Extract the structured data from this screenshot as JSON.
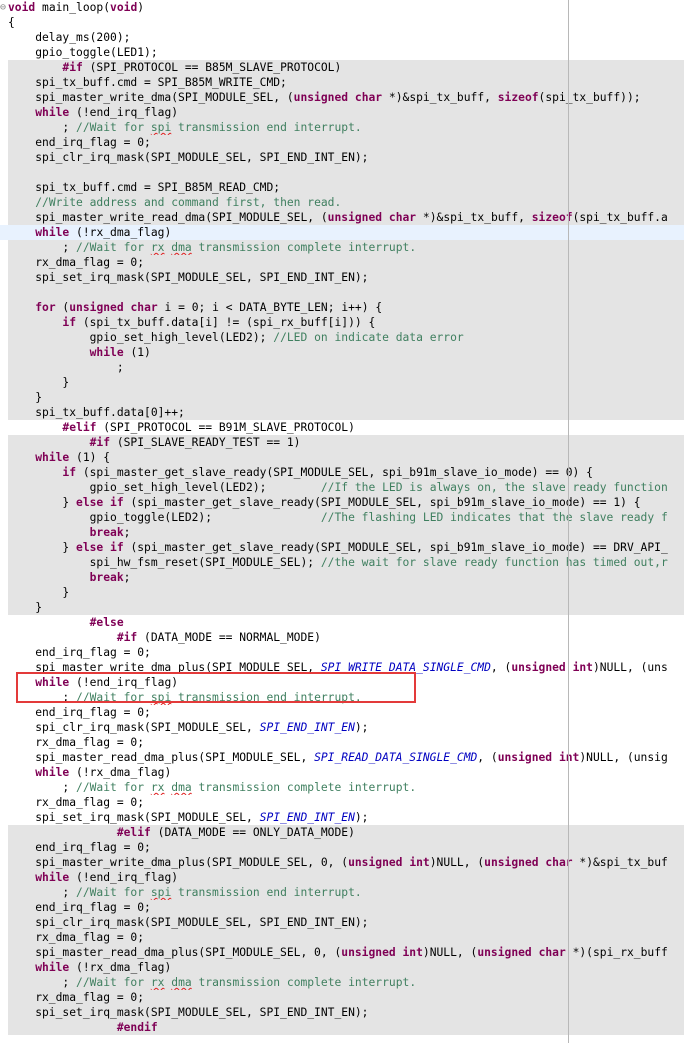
{
  "fold_marker": "⊖",
  "highlight_color": "#e33a3a",
  "lines": [
    {
      "text": "void main_loop(void)",
      "indent": 0
    },
    {
      "text": "{",
      "indent": 0
    },
    {
      "text": "    delay_ms(200);",
      "indent": 0
    },
    {
      "text": "    gpio_toggle(LED1);",
      "indent": 0
    },
    {
      "text": "        #if (SPI_PROTOCOL == B85M_SLAVE_PROTOCOL)",
      "indent": 0,
      "gray": true
    },
    {
      "text": "    spi_tx_buff.cmd = SPI_B85M_WRITE_CMD;",
      "indent": 0,
      "gray": true
    },
    {
      "text": "    spi_master_write_dma(SPI_MODULE_SEL, (unsigned char *)&spi_tx_buff, sizeof(spi_tx_buff));",
      "indent": 0,
      "gray": true
    },
    {
      "text": "    while (!end_irq_flag)",
      "indent": 0,
      "gray": true
    },
    {
      "text": "        ; //Wait for spi transmission end interrupt.",
      "indent": 0,
      "gray": true
    },
    {
      "text": "    end_irq_flag = 0;",
      "indent": 0,
      "gray": true
    },
    {
      "text": "    spi_clr_irq_mask(SPI_MODULE_SEL, SPI_END_INT_EN);",
      "indent": 0,
      "gray": true
    },
    {
      "text": "",
      "indent": 0,
      "gray": true
    },
    {
      "text": "    spi_tx_buff.cmd = SPI_B85M_READ_CMD;",
      "indent": 0,
      "gray": true
    },
    {
      "text": "    //Write address and command first, then read.",
      "indent": 0,
      "gray": true
    },
    {
      "text": "    spi_master_write_read_dma(SPI_MODULE_SEL, (unsigned char *)&spi_tx_buff, sizeof(spi_tx_buff.a",
      "indent": 0,
      "gray": true
    },
    {
      "text": "    while (!rx_dma_flag)",
      "indent": 0,
      "sel": true
    },
    {
      "text": "        ; //Wait for rx dma transmission complete interrupt.",
      "indent": 0,
      "gray": true
    },
    {
      "text": "    rx_dma_flag = 0;",
      "indent": 0,
      "gray": true
    },
    {
      "text": "    spi_set_irq_mask(SPI_MODULE_SEL, SPI_END_INT_EN);",
      "indent": 0,
      "gray": true
    },
    {
      "text": "",
      "indent": 0,
      "gray": true
    },
    {
      "text": "    for (unsigned char i = 0; i < DATA_BYTE_LEN; i++) {",
      "indent": 0,
      "gray": true
    },
    {
      "text": "        if (spi_tx_buff.data[i] != (spi_rx_buff[i])) {",
      "indent": 0,
      "gray": true
    },
    {
      "text": "            gpio_set_high_level(LED2); //LED on indicate data error",
      "indent": 0,
      "gray": true
    },
    {
      "text": "            while (1)",
      "indent": 0,
      "gray": true
    },
    {
      "text": "                ;",
      "indent": 0,
      "gray": true
    },
    {
      "text": "        }",
      "indent": 0,
      "gray": true
    },
    {
      "text": "    }",
      "indent": 0,
      "gray": true
    },
    {
      "text": "    spi_tx_buff.data[0]++;",
      "indent": 0,
      "gray": true
    },
    {
      "text": "        #elif (SPI_PROTOCOL == B91M_SLAVE_PROTOCOL)",
      "indent": 0
    },
    {
      "text": "            #if (SPI_SLAVE_READY_TEST == 1)",
      "indent": 0,
      "gray": true
    },
    {
      "text": "    while (1) {",
      "indent": 0,
      "gray": true
    },
    {
      "text": "        if (spi_master_get_slave_ready(SPI_MODULE_SEL, spi_b91m_slave_io_mode) == 0) {",
      "indent": 0,
      "gray": true
    },
    {
      "text": "            gpio_set_high_level(LED2);        //If the LED is always on, the slave ready function",
      "indent": 0,
      "gray": true
    },
    {
      "text": "        } else if (spi_master_get_slave_ready(SPI_MODULE_SEL, spi_b91m_slave_io_mode) == 1) {",
      "indent": 0,
      "gray": true
    },
    {
      "text": "            gpio_toggle(LED2);                //The flashing LED indicates that the slave ready f",
      "indent": 0,
      "gray": true
    },
    {
      "text": "            break;",
      "indent": 0,
      "gray": true
    },
    {
      "text": "        } else if (spi_master_get_slave_ready(SPI_MODULE_SEL, spi_b91m_slave_io_mode) == DRV_API_",
      "indent": 0,
      "gray": true
    },
    {
      "text": "            spi_hw_fsm_reset(SPI_MODULE_SEL); //the wait for slave ready function has timed out,r",
      "indent": 0,
      "gray": true
    },
    {
      "text": "            break;",
      "indent": 0,
      "gray": true
    },
    {
      "text": "        }",
      "indent": 0,
      "gray": true
    },
    {
      "text": "    }",
      "indent": 0,
      "gray": true
    },
    {
      "text": "            #else",
      "indent": 0
    },
    {
      "text": "                #if (DATA_MODE == NORMAL_MODE)",
      "indent": 0
    },
    {
      "text": "    end_irq_flag = 0;",
      "indent": 0
    },
    {
      "text": "    spi_master_write_dma_plus(SPI_MODULE_SEL, SPI_WRITE_DATA_SINGLE_CMD, (unsigned int)NULL, (uns",
      "indent": 0
    },
    {
      "text": "    while (!end_irq_flag)",
      "indent": 0
    },
    {
      "text": "        ; //Wait for spi transmission end interrupt.",
      "indent": 0
    },
    {
      "text": "    end_irq_flag = 0;",
      "indent": 0
    },
    {
      "text": "    spi_clr_irq_mask(SPI_MODULE_SEL, SPI_END_INT_EN);",
      "indent": 0
    },
    {
      "text": "    rx_dma_flag = 0;",
      "indent": 0
    },
    {
      "text": "    spi_master_read_dma_plus(SPI_MODULE_SEL, SPI_READ_DATA_SINGLE_CMD, (unsigned int)NULL, (unsig",
      "indent": 0
    },
    {
      "text": "    while (!rx_dma_flag)",
      "indent": 0
    },
    {
      "text": "        ; //Wait for rx dma transmission complete interrupt.",
      "indent": 0
    },
    {
      "text": "    rx_dma_flag = 0;",
      "indent": 0
    },
    {
      "text": "    spi_set_irq_mask(SPI_MODULE_SEL, SPI_END_INT_EN);",
      "indent": 0
    },
    {
      "text": "                #elif (DATA_MODE == ONLY_DATA_MODE)",
      "indent": 0,
      "gray": true
    },
    {
      "text": "    end_irq_flag = 0;",
      "indent": 0,
      "gray": true
    },
    {
      "text": "    spi_master_write_dma_plus(SPI_MODULE_SEL, 0, (unsigned int)NULL, (unsigned char *)&spi_tx_buf",
      "indent": 0,
      "gray": true
    },
    {
      "text": "    while (!end_irq_flag)",
      "indent": 0,
      "gray": true
    },
    {
      "text": "        ; //Wait for spi transmission end interrupt.",
      "indent": 0,
      "gray": true
    },
    {
      "text": "    end_irq_flag = 0;",
      "indent": 0,
      "gray": true
    },
    {
      "text": "    spi_clr_irq_mask(SPI_MODULE_SEL, SPI_END_INT_EN);",
      "indent": 0,
      "gray": true
    },
    {
      "text": "    rx_dma_flag = 0;",
      "indent": 0,
      "gray": true
    },
    {
      "text": "    spi_master_read_dma_plus(SPI_MODULE_SEL, 0, (unsigned int)NULL, (unsigned char *)(spi_rx_buff",
      "indent": 0,
      "gray": true
    },
    {
      "text": "    while (!rx_dma_flag)",
      "indent": 0,
      "gray": true
    },
    {
      "text": "        ; //Wait for rx dma transmission complete interrupt.",
      "indent": 0,
      "gray": true
    },
    {
      "text": "    rx_dma_flag = 0;",
      "indent": 0,
      "gray": true
    },
    {
      "text": "    spi_set_irq_mask(SPI_MODULE_SEL, SPI_END_INT_EN);",
      "indent": 0,
      "gray": true
    },
    {
      "text": "                #endif",
      "indent": 0,
      "gray": true
    }
  ]
}
